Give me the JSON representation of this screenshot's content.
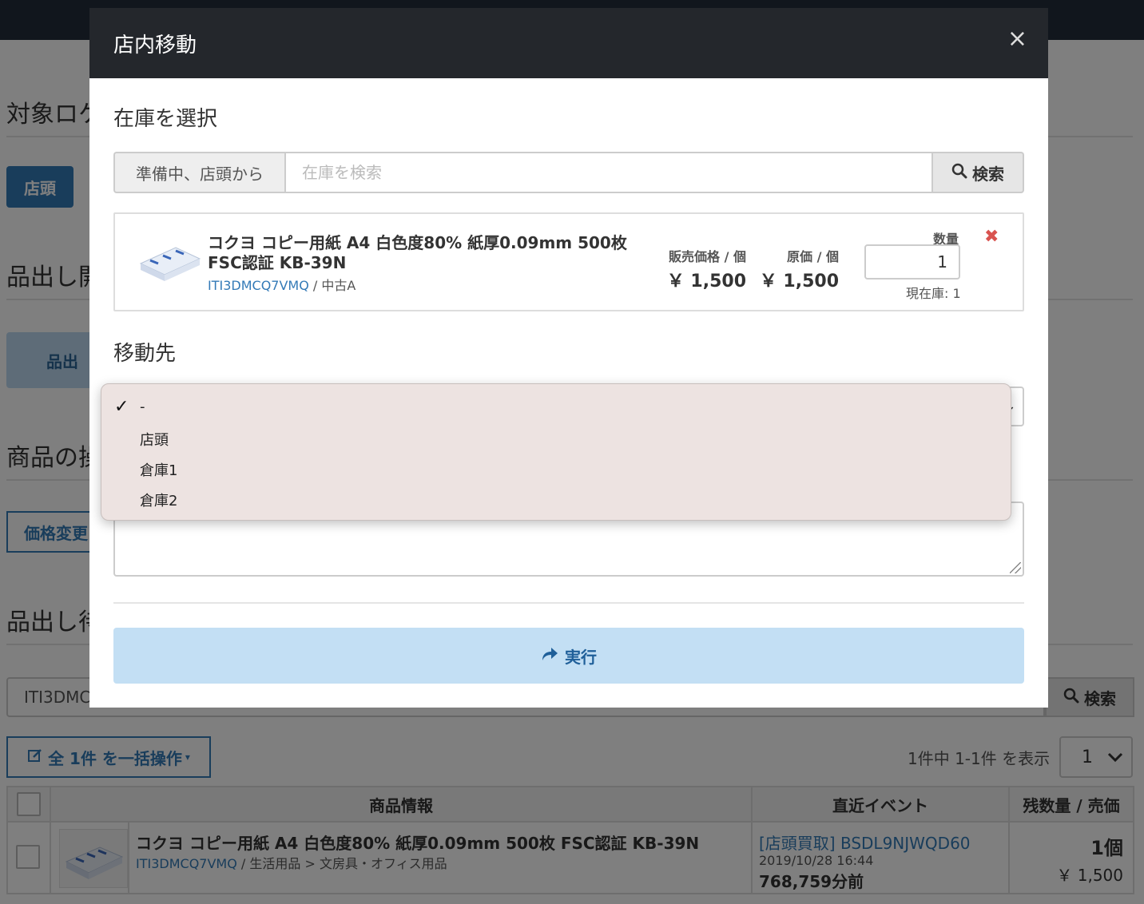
{
  "background": {
    "sections": {
      "target_location": "対象ロケ",
      "shelving_start": "品出し開",
      "product_ops": "商品の操",
      "shelving_wait": "品出し待"
    },
    "storefront_button": "店頭",
    "shelving_button": "品出",
    "price_change_button": "価格変更",
    "search_value": "ITI3DMC",
    "search_button": "検索",
    "bulk_button": "全 1件 を一括操作",
    "result_count": "1件中 1-1件 を表示",
    "page_select": "1",
    "table": {
      "headers": [
        "商品情報",
        "直近イベント",
        "残数量 / 売価"
      ],
      "row": {
        "title": "コクヨ コピー用紙 A4 白色度80% 紙厚0.09mm 500枚 FSC認証 KB-39N",
        "code": "ITI3DMCQ7VMQ",
        "category": " / 生活用品 > 文房具・オフィス用品",
        "event_title": "[店頭買取] BSDL9NJWQD60",
        "event_date": "2019/10/28 16:44",
        "event_minutes": "768,759分前",
        "stock": "1個",
        "price": "￥ 1,500"
      }
    }
  },
  "modal": {
    "title": "店内移動",
    "close": "×",
    "select_stock_title": "在庫を選択",
    "search": {
      "addon": "準備中、店頭から",
      "placeholder": "在庫を検索",
      "button": "検索"
    },
    "item": {
      "title": "コクヨ コピー用紙 A4 白色度80% 紙厚0.09mm 500枚 FSC認証 KB-39N",
      "code": "ITI3DMCQ7VMQ",
      "condition": " / 中古A",
      "sale_price_label": "販売価格 / 個",
      "sale_price": "￥ 1,500",
      "cost_label": "原価 / 個",
      "cost": "￥ 1,500",
      "qty_label": "数量",
      "qty_value": "1",
      "stock_note": "現在庫: 1"
    },
    "destination_title": "移動先",
    "destination": {
      "selected": "-",
      "options": [
        "-",
        "店頭",
        "倉庫1",
        "倉庫2"
      ]
    },
    "execute_button": "実行"
  },
  "colors": {
    "header_dark": "#24272c",
    "primary": "#337ab7",
    "execute_bg": "#c3dff4",
    "danger": "#d9534f",
    "dropdown_bg": "#ede3e1"
  }
}
